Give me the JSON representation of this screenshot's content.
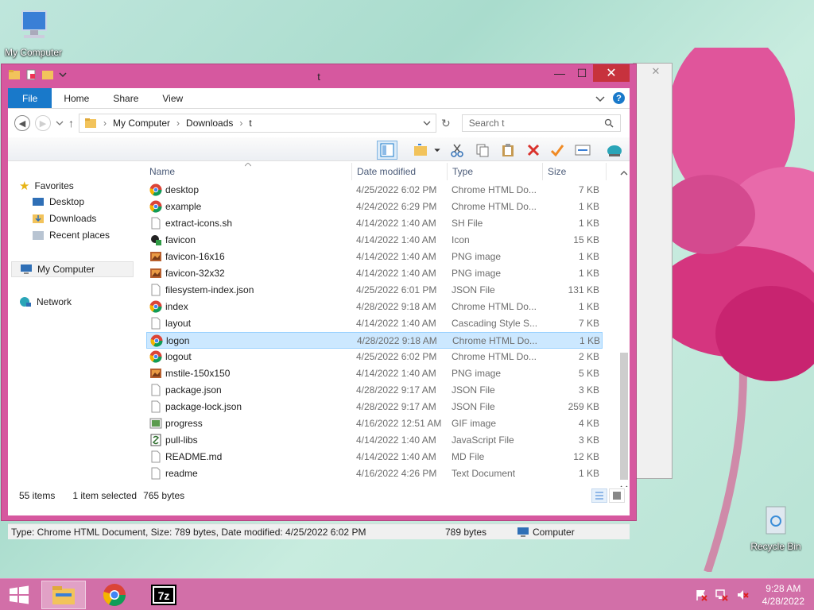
{
  "desktop": {
    "my_computer_label": "My Computer",
    "recycle_bin_label": "Recycle Bin"
  },
  "window": {
    "title": "t",
    "minimize": "—",
    "maximize": "☐",
    "close": "✕"
  },
  "bg_window": {
    "close": "✕"
  },
  "ribbon": {
    "tabs": [
      "File",
      "Home",
      "Share",
      "View"
    ],
    "help": "?"
  },
  "address": {
    "crumbs": [
      "My Computer",
      "Downloads",
      "t"
    ],
    "search_placeholder": "Search t"
  },
  "nav_pane": {
    "favorites": "Favorites",
    "desktop": "Desktop",
    "downloads": "Downloads",
    "recent": "Recent places",
    "my_computer": "My Computer",
    "network": "Network"
  },
  "columns": {
    "name": "Name",
    "date": "Date modified",
    "type": "Type",
    "size": "Size"
  },
  "files": [
    {
      "name": "desktop",
      "date": "4/25/2022 6:02 PM",
      "type": "Chrome HTML Do...",
      "size": "7 KB",
      "icon": "chrome"
    },
    {
      "name": "example",
      "date": "4/24/2022 6:29 PM",
      "type": "Chrome HTML Do...",
      "size": "1 KB",
      "icon": "chrome"
    },
    {
      "name": "extract-icons.sh",
      "date": "4/14/2022 1:40 AM",
      "type": "SH File",
      "size": "1 KB",
      "icon": "file"
    },
    {
      "name": "favicon",
      "date": "4/14/2022 1:40 AM",
      "type": "Icon",
      "size": "15 KB",
      "icon": "icon"
    },
    {
      "name": "favicon-16x16",
      "date": "4/14/2022 1:40 AM",
      "type": "PNG image",
      "size": "1 KB",
      "icon": "image"
    },
    {
      "name": "favicon-32x32",
      "date": "4/14/2022 1:40 AM",
      "type": "PNG image",
      "size": "1 KB",
      "icon": "image"
    },
    {
      "name": "filesystem-index.json",
      "date": "4/25/2022 6:01 PM",
      "type": "JSON File",
      "size": "131 KB",
      "icon": "file"
    },
    {
      "name": "index",
      "date": "4/28/2022 9:18 AM",
      "type": "Chrome HTML Do...",
      "size": "1 KB",
      "icon": "chrome"
    },
    {
      "name": "layout",
      "date": "4/14/2022 1:40 AM",
      "type": "Cascading Style S...",
      "size": "7 KB",
      "icon": "file"
    },
    {
      "name": "logon",
      "date": "4/28/2022 9:18 AM",
      "type": "Chrome HTML Do...",
      "size": "1 KB",
      "icon": "chrome"
    },
    {
      "name": "logout",
      "date": "4/25/2022 6:02 PM",
      "type": "Chrome HTML Do...",
      "size": "2 KB",
      "icon": "chrome"
    },
    {
      "name": "mstile-150x150",
      "date": "4/14/2022 1:40 AM",
      "type": "PNG image",
      "size": "5 KB",
      "icon": "image"
    },
    {
      "name": "package.json",
      "date": "4/28/2022 9:17 AM",
      "type": "JSON File",
      "size": "3 KB",
      "icon": "file"
    },
    {
      "name": "package-lock.json",
      "date": "4/28/2022 9:17 AM",
      "type": "JSON File",
      "size": "259 KB",
      "icon": "file"
    },
    {
      "name": "progress",
      "date": "4/16/2022 12:51 AM",
      "type": "GIF image",
      "size": "4 KB",
      "icon": "gif"
    },
    {
      "name": "pull-libs",
      "date": "4/14/2022 1:40 AM",
      "type": "JavaScript File",
      "size": "3 KB",
      "icon": "script"
    },
    {
      "name": "README.md",
      "date": "4/14/2022 1:40 AM",
      "type": "MD File",
      "size": "12 KB",
      "icon": "file"
    },
    {
      "name": "readme",
      "date": "4/16/2022 4:26 PM",
      "type": "Text Document",
      "size": "1 KB",
      "icon": "file"
    }
  ],
  "selected_index": 9,
  "status": {
    "items": "55 items",
    "selected": "1 item selected",
    "bytes": "765 bytes"
  },
  "bottombar": {
    "details": "Type: Chrome HTML Document, Size: 789 bytes, Date modified: 4/25/2022 6:02 PM",
    "size": "789 bytes",
    "location": "Computer"
  },
  "clock": {
    "time": "9:28 AM",
    "date": "4/28/2022"
  },
  "colors": {
    "accent": "#1979ca",
    "window_frame": "#d6589f",
    "taskbar": "#d26fa8",
    "selection": "#cce8ff"
  }
}
